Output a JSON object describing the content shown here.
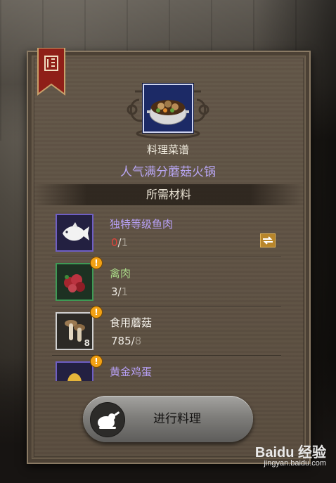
{
  "recipe": {
    "label": "料理菜谱",
    "name": "人气满分蘑菇火锅"
  },
  "materials": {
    "header": "所需材料",
    "items": [
      {
        "name": "独特等级鱼肉",
        "have": "0",
        "need": "1",
        "grade": "purple",
        "icon": "fish-icon",
        "alert": false,
        "tradeable": true,
        "stack": ""
      },
      {
        "name": "禽肉",
        "have": "3",
        "need": "1",
        "grade": "green",
        "icon": "poultry-meat-icon",
        "alert": true,
        "tradeable": false,
        "stack": ""
      },
      {
        "name": "食用蘑菇",
        "have": "785",
        "need": "8",
        "grade": "white",
        "icon": "mushroom-icon",
        "alert": true,
        "tradeable": false,
        "stack": "8"
      },
      {
        "name": "黄金鸡蛋",
        "have": "",
        "need": "",
        "grade": "purple",
        "icon": "golden-egg-icon",
        "alert": true,
        "tradeable": false,
        "stack": ""
      }
    ],
    "qty_separator": "/"
  },
  "actions": {
    "cook_label": "进行料理",
    "cook_icon": "roast-chicken-icon"
  },
  "watermark": {
    "logo": "Baidu 经验",
    "url": "jingyan.baidu.com"
  },
  "colors": {
    "grade_purple": "#b7a0f5",
    "grade_green": "#a7d486",
    "missing_red": "#e0433a",
    "alert_orange": "#f2a114"
  }
}
